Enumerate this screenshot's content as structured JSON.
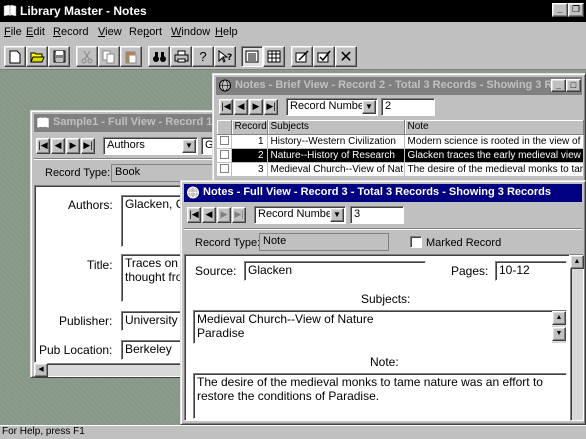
{
  "app": {
    "title": "Library Master - Notes",
    "menu": [
      "File",
      "Edit",
      "Record",
      "View",
      "Report",
      "Window",
      "Help"
    ],
    "menu_accel": [
      "F",
      "E",
      "R",
      "V",
      "p",
      "W",
      "H"
    ],
    "status": "For Help, press F1"
  },
  "sample1": {
    "title": "Sample1 - Full View - Record 1 -",
    "index_field": "Authors",
    "goto_value": "Gl",
    "record_type_label": "Record Type:",
    "record_type_value": "Book",
    "authors_label": "Authors:",
    "authors_value": "Glacken, C",
    "title_label": "Title:",
    "title_value_line1": "Traces on t",
    "title_value_line2": "thought fror",
    "publisher_label": "Publisher:",
    "publisher_value": "University o",
    "publoc_label": "Pub Location:",
    "publoc_value": "Berkeley"
  },
  "brief": {
    "title": "Notes - Brief View - Record 2 - Total 3 Records - Showing 3 Re...",
    "index_field": "Record Number",
    "goto_value": "2",
    "columns": [
      "",
      "Record",
      "Subjects",
      "Note"
    ],
    "rows": [
      {
        "record": "1",
        "subjects": "History--Western Civilization",
        "note": "Modern science is rooted in the view of"
      },
      {
        "record": "2",
        "subjects": "Nature--History of Research",
        "note": "Glacken traces the early medieval view"
      },
      {
        "record": "3",
        "subjects": "Medieval Church--View of Nat",
        "note": "The desire of the medieval monks to tar"
      }
    ]
  },
  "full": {
    "title": "Notes - Full View - Record 3 - Total 3 Records - Showing 3 Records",
    "index_field": "Record Number",
    "goto_value": "3",
    "record_type_label": "Record Type:",
    "record_type_value": "Note",
    "marked_label": "Marked Record",
    "source_label": "Source:",
    "source_value": "Glacken",
    "pages_label": "Pages:",
    "pages_value": "10-12",
    "subjects_label": "Subjects:",
    "subjects_line1": "Medieval Church--View of Nature",
    "subjects_line2": "Paradise",
    "note_label": "Note:",
    "note_line1": "The desire of the medieval monks to tame nature was an effort to",
    "note_line2": "restore the conditions of Paradise."
  }
}
